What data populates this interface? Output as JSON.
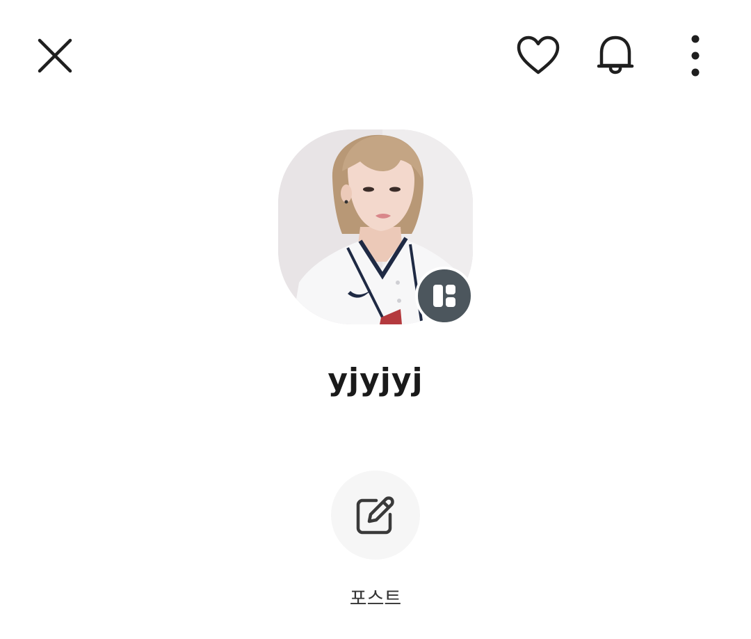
{
  "profile": {
    "username": "yjyjyj"
  },
  "actions": {
    "post_label": "포스트"
  },
  "icons": {
    "close": "close-icon",
    "like": "heart-icon",
    "notify": "bell-icon",
    "more": "more-vertical-icon",
    "badge": "board-icon",
    "post": "edit-icon"
  },
  "colors": {
    "icon": "#1f1f1f",
    "badge_bg": "#4c565d",
    "post_button_bg": "#f6f6f6"
  }
}
